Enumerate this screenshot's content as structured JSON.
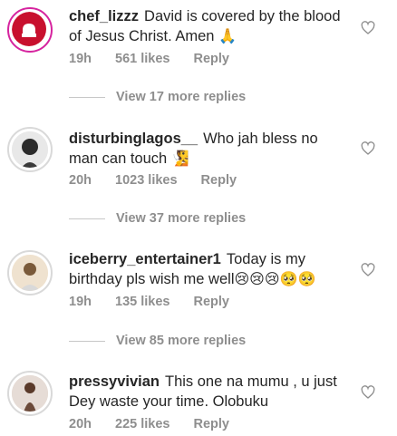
{
  "comments": [
    {
      "username": "chef_lizzz",
      "text": "David is covered by the blood of Jesus Christ. Amen",
      "emoji": "🙏",
      "time": "19h",
      "likes": "561 likes",
      "reply": "Reply",
      "view_replies": "View 17 more replies"
    },
    {
      "username": "disturbinglagos__",
      "text": "Who jah bless no man can touch",
      "emoji": "🧏",
      "time": "20h",
      "likes": "1023 likes",
      "reply": "Reply",
      "view_replies": "View 37 more replies"
    },
    {
      "username": "iceberry_entertainer1",
      "text": "Today is my birthday pls wish me well",
      "emoji": "😢😢😢🥺🥺",
      "time": "19h",
      "likes": "135 likes",
      "reply": "Reply",
      "view_replies": "View 85 more replies"
    },
    {
      "username": "pressyvivian",
      "text": "This one na mumu , u just Dey waste your time. Olobuku",
      "emoji": "",
      "time": "20h",
      "likes": "225 likes",
      "reply": "Reply"
    }
  ],
  "colors": {
    "text": "#262626",
    "muted": "#8e8e8e",
    "story_ring": "#d6249f",
    "chef_logo": "#c8102e"
  }
}
